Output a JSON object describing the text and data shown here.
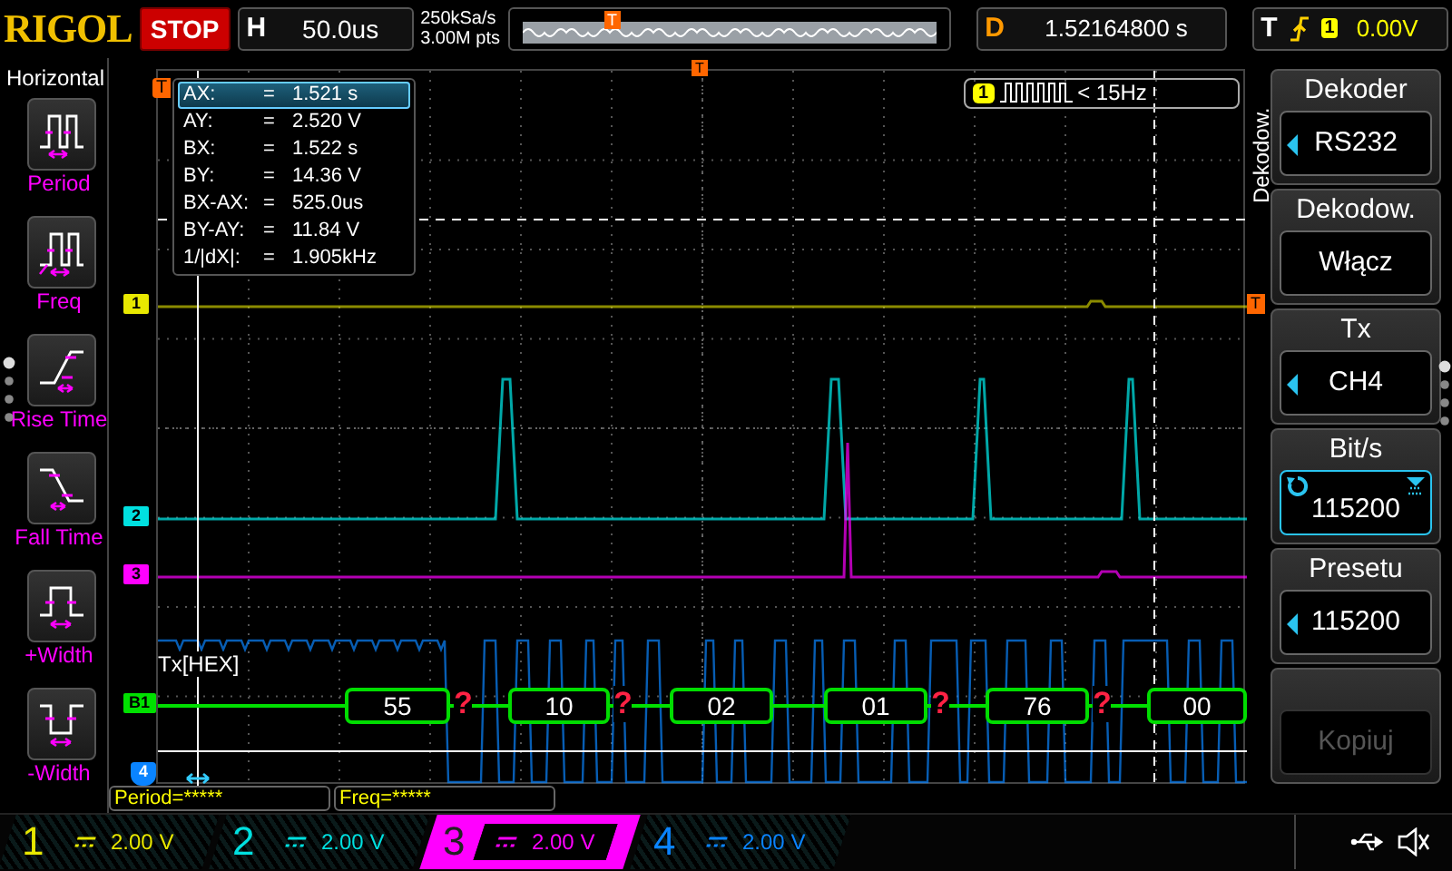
{
  "brand": "RIGOL",
  "run_state": "STOP",
  "timebase": {
    "label": "H",
    "value": "50.0us"
  },
  "sample_rate": "250kSa/s",
  "memory_depth": "3.00M pts",
  "trigger_markers": {
    "overview": "T",
    "top": "T",
    "left": "T",
    "right": "T"
  },
  "delay": {
    "label": "D",
    "value": "1.52164800 s"
  },
  "trigger": {
    "label": "T",
    "source": "1",
    "level": "0.00V"
  },
  "left_menu": {
    "title": "Horizontal",
    "items": [
      {
        "kind": "period",
        "label": "Period"
      },
      {
        "kind": "freq",
        "label": "Freq"
      },
      {
        "kind": "rise",
        "label": "Rise Time"
      },
      {
        "kind": "fall",
        "label": "Fall Time"
      },
      {
        "kind": "pwidth",
        "label": "+Width"
      },
      {
        "kind": "nwidth",
        "label": "-Width"
      }
    ]
  },
  "cursor_readout": [
    {
      "name": "AX:",
      "value": "1.521 s",
      "selected": true
    },
    {
      "name": "AY:",
      "value": "2.520 V",
      "selected": false
    },
    {
      "name": "BX:",
      "value": "1.522 s",
      "selected": false
    },
    {
      "name": "BY:",
      "value": "14.36 V",
      "selected": false
    },
    {
      "name": "BX-AX:",
      "value": "525.0us",
      "selected": false
    },
    {
      "name": "BY-AY:",
      "value": "11.84 V",
      "selected": false
    },
    {
      "name": "1/|dX|:",
      "value": "1.905kHz",
      "selected": false
    }
  ],
  "equals": "=",
  "frequency_badge": {
    "channel": "1",
    "text": "< 15Hz"
  },
  "trace_markers": [
    {
      "label": "1",
      "color": "#e8e800"
    },
    {
      "label": "2",
      "color": "#00e0e0"
    },
    {
      "label": "3",
      "color": "#ff00ff"
    },
    {
      "label": "B1",
      "color": "#00e000"
    },
    {
      "label": "4",
      "color": "#0a84ff"
    }
  ],
  "decode": {
    "label": "Tx[HEX]",
    "frames": [
      {
        "value": "55",
        "error": true
      },
      {
        "value": "10",
        "error": true
      },
      {
        "value": "02",
        "error": false
      },
      {
        "value": "01",
        "error": true
      },
      {
        "value": "76",
        "error": true
      },
      {
        "value": "00",
        "error": false
      }
    ],
    "error_mark": "?"
  },
  "measurements": [
    "Period=*****",
    "Freq=*****"
  ],
  "menu_tab": "Dekodow.",
  "right_menu": [
    {
      "kind": "select",
      "title": "Dekoder",
      "value": "RS232"
    },
    {
      "kind": "plain",
      "title": "Dekodow.",
      "value": "Włącz"
    },
    {
      "kind": "select",
      "title": "Tx",
      "value": "CH4"
    },
    {
      "kind": "knob",
      "title": "Bit/s",
      "value": "115200"
    },
    {
      "kind": "select",
      "title": "Presetu",
      "value": "115200"
    },
    {
      "kind": "disabled",
      "value": "Kopiuj"
    }
  ],
  "channels": [
    {
      "number": "1",
      "scale": "2.00 V",
      "color": "#e8e800",
      "selected": false
    },
    {
      "number": "2",
      "scale": "2.00 V",
      "color": "#00e0e0",
      "selected": false
    },
    {
      "number": "3",
      "scale": "2.00 V",
      "color": "#ff00ff",
      "selected": true
    },
    {
      "number": "4",
      "scale": "2.00 V",
      "color": "#0a84ff",
      "selected": false
    }
  ]
}
